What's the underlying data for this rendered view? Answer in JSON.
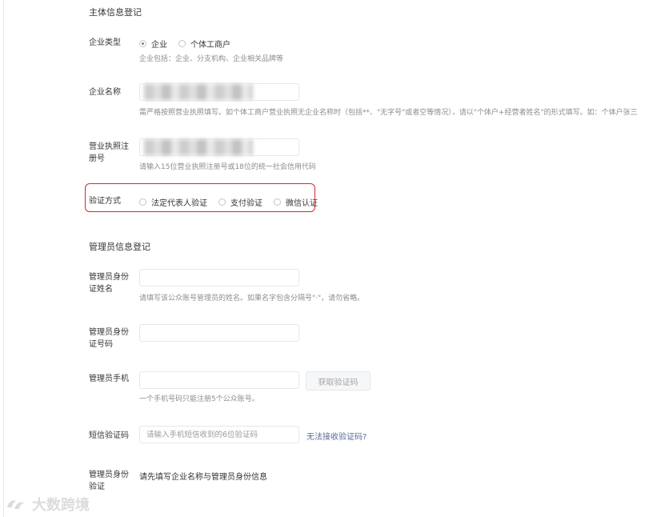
{
  "entity_section": {
    "title": "主体信息登记",
    "enterprise_type": {
      "label": "企业类型",
      "options": [
        {
          "label": "企业",
          "checked": true
        },
        {
          "label": "个体工商户",
          "checked": false
        }
      ],
      "hint": "企业包括：企业、分支机构、企业相关品牌等"
    },
    "enterprise_name": {
      "label": "企业名称",
      "value": "",
      "hint": "需严格按照营业执照填写。如个体工商户营业执照无企业名称时（包括**、\"无字号\"或者空等情况），请以\"个体户+经营者姓名\"的形式填写。如：个体户张三"
    },
    "license_number": {
      "label": "营业执照注册号",
      "value": "",
      "hint": "请输入15位营业执照注册号或18位的统一社会信用代码"
    },
    "verification_method": {
      "label": "验证方式",
      "options": [
        {
          "label": "法定代表人验证",
          "checked": false
        },
        {
          "label": "支付验证",
          "checked": false
        },
        {
          "label": "微信认证",
          "checked": false
        }
      ],
      "highlight_color": "#d8272d"
    }
  },
  "admin_section": {
    "title": "管理员信息登记",
    "admin_name": {
      "label": "管理员身份证姓名",
      "value": "",
      "hint": "请填写该公众账号管理员的姓名。如果名字包含分隔号\"·\"，请勿省略。"
    },
    "admin_id": {
      "label": "管理员身份证号码",
      "value": ""
    },
    "admin_phone": {
      "label": "管理员手机",
      "value": "",
      "get_code_button": "获取验证码",
      "hint": "一个手机号码只能注册5个公众账号。"
    },
    "sms_code": {
      "label": "短信验证码",
      "placeholder": "请输入手机短信收到的6位验证码",
      "link": "无法接收验证码?"
    },
    "admin_verify": {
      "label": "管理员身份验证",
      "text": "请先填写企业名称与管理员身份信息"
    }
  },
  "watermark": {
    "text": "大数跨境"
  },
  "colors": {
    "link": "#576b95",
    "hint": "#8d8d8d",
    "text": "#353535"
  }
}
